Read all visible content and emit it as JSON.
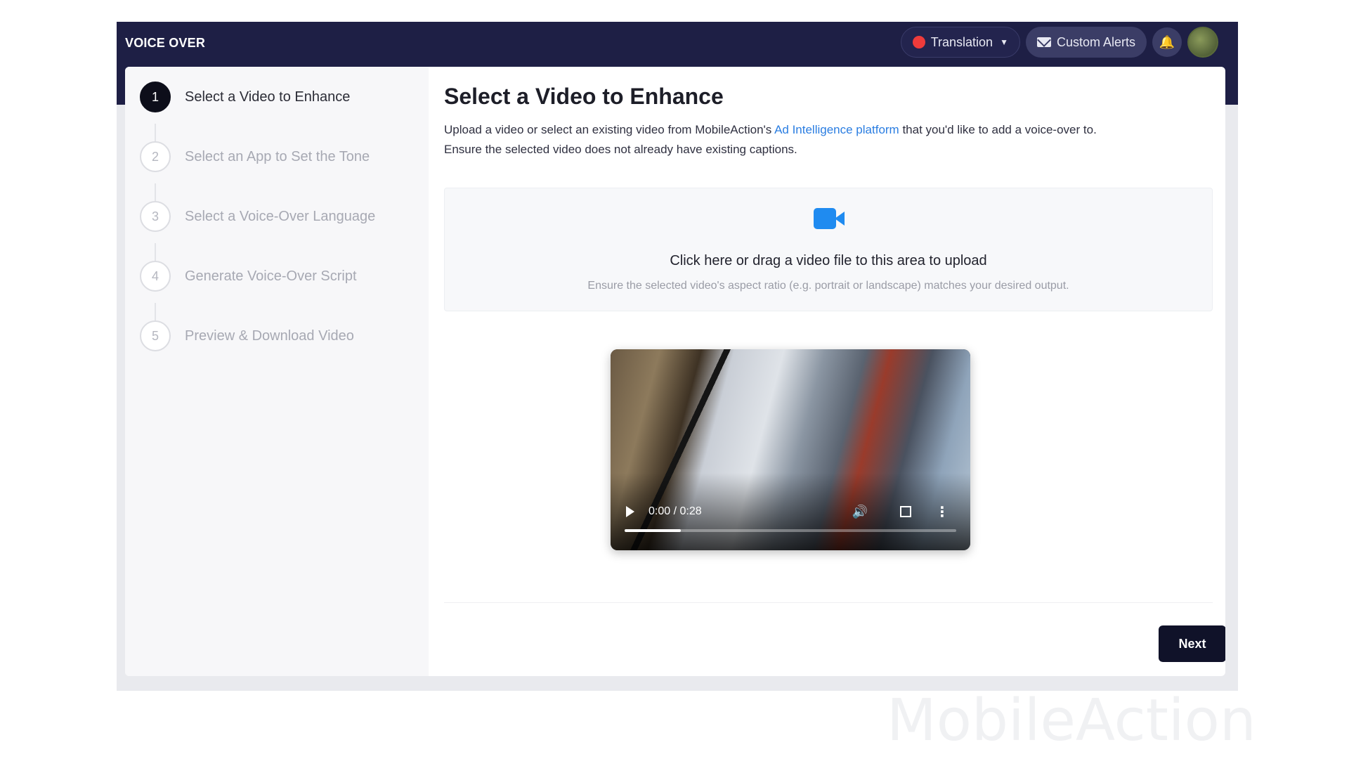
{
  "header": {
    "brand": "VOICE OVER",
    "translation_label": "Translation",
    "custom_alerts_label": "Custom Alerts"
  },
  "steps": [
    {
      "number": "1",
      "label": "Select a Video to Enhance",
      "active": true
    },
    {
      "number": "2",
      "label": "Select an App to Set the Tone",
      "active": false
    },
    {
      "number": "3",
      "label": "Select a Voice-Over Language",
      "active": false
    },
    {
      "number": "4",
      "label": "Generate Voice-Over Script",
      "active": false
    },
    {
      "number": "5",
      "label": "Preview & Download Video",
      "active": false
    }
  ],
  "main": {
    "title": "Select a Video to Enhance",
    "desc_part1": "Upload a video or select an existing video from MobileAction's ",
    "desc_link": "Ad Intelligence platform",
    "desc_part2": " that you'd like to add a voice-over to.",
    "desc_line2": "Ensure the selected video does not already have existing captions."
  },
  "dropzone": {
    "main_text": "Click here or drag a video file to this area to upload",
    "sub_text": "Ensure the selected video's aspect ratio (e.g. portrait or landscape) matches your desired output."
  },
  "video": {
    "time": "0:00 / 0:28",
    "progress_fraction": 0.17
  },
  "footer": {
    "next_label": "Next"
  },
  "watermark": "MobileAction",
  "icons": {
    "translation": "red-dot-icon",
    "alerts": "mail-icon",
    "notifications": "bell-icon",
    "upload": "video-camera-icon",
    "play": "play-icon",
    "volume": "volume-icon",
    "fullscreen": "fullscreen-icon",
    "more": "more-vertical-icon"
  },
  "colors": {
    "topbar": "#1e1f45",
    "accent_link": "#2a7de1",
    "upload_icon": "#1f8bf0",
    "next_button": "#101229"
  }
}
